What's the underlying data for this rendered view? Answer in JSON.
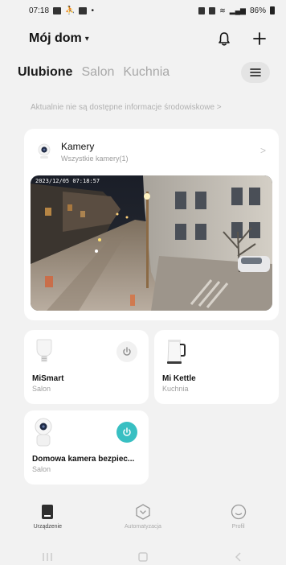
{
  "status_bar": {
    "time": "07:18",
    "dot": "•",
    "battery": "86%"
  },
  "header": {
    "home_name": "Mój dom",
    "caret": "▾"
  },
  "tabs": [
    {
      "label": "Ulubione",
      "active": true
    },
    {
      "label": "Salon",
      "active": false
    },
    {
      "label": "Kuchnia",
      "active": false
    }
  ],
  "env_info": "Aktualnie nie są dostępne informacje środowiskowe >",
  "cameras": {
    "title": "Kamery",
    "subtitle": "Wszystkie kamery(1)",
    "chevron": ">",
    "timestamp": "2023/12/05 07:18:57"
  },
  "devices": [
    {
      "name": "MiSmart",
      "room": "Salon"
    },
    {
      "name": "Mi Kettle",
      "room": "Kuchnia"
    },
    {
      "name": "Domowa kamera bezpiec...",
      "room": "Salon"
    }
  ],
  "bottom_nav": [
    {
      "label": "Urządzenie",
      "icon": "device-icon",
      "active": true
    },
    {
      "label": "Automatyzacja",
      "icon": "automation-icon",
      "active": false
    },
    {
      "label": "Profil",
      "icon": "profile-icon",
      "active": false
    }
  ],
  "colors": {
    "accent": "#38bfc2",
    "background": "#f2f2f2",
    "card": "#ffffff"
  }
}
